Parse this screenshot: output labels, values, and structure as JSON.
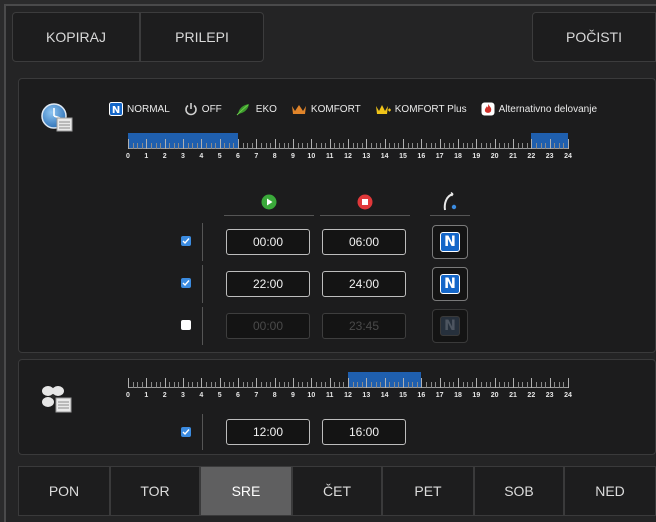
{
  "toolbar": {
    "copy_label": "KOPIRAJ",
    "paste_label": "PRILEPI",
    "clear_label": "POČISTI"
  },
  "legend": [
    {
      "label": "NORMAL",
      "icon": "normal-n-icon",
      "color": "#1466c8"
    },
    {
      "label": "OFF",
      "icon": "power-icon",
      "color": "#cfcfcf"
    },
    {
      "label": "EKO",
      "icon": "leaf-icon",
      "color": "#3c9a2c"
    },
    {
      "label": "KOMFORT",
      "icon": "crown-icon",
      "color": "#e0842a"
    },
    {
      "label": "KOMFORT Plus",
      "icon": "crown-plus-icon",
      "color": "#f0c419"
    },
    {
      "label": "Alternativno delovanje",
      "icon": "flame-icon",
      "color": "#d0302a"
    }
  ],
  "hours": [
    "0",
    "1",
    "2",
    "3",
    "4",
    "5",
    "6",
    "7",
    "8",
    "9",
    "10",
    "11",
    "12",
    "13",
    "14",
    "15",
    "16",
    "17",
    "18",
    "19",
    "20",
    "21",
    "22",
    "23",
    "24"
  ],
  "heating": {
    "timeline_segments": [
      [
        0,
        6
      ],
      [
        22,
        24
      ]
    ],
    "columns": {
      "start_icon": "play-icon",
      "stop_icon": "stop-icon",
      "mode_icon": "touch-icon"
    },
    "rows": [
      {
        "enabled": true,
        "start": "00:00",
        "end": "06:00",
        "mode": "N"
      },
      {
        "enabled": true,
        "start": "22:00",
        "end": "24:00",
        "mode": "N"
      },
      {
        "enabled": false,
        "start": "00:00",
        "end": "23:45",
        "mode": "N"
      }
    ]
  },
  "ventilation": {
    "timeline_segments": [
      [
        12,
        16
      ]
    ],
    "rows": [
      {
        "enabled": true,
        "start": "12:00",
        "end": "16:00"
      }
    ]
  },
  "days": [
    {
      "label": "PON",
      "active": false
    },
    {
      "label": "TOR",
      "active": false
    },
    {
      "label": "SRE",
      "active": true
    },
    {
      "label": "ČET",
      "active": false
    },
    {
      "label": "PET",
      "active": false
    },
    {
      "label": "SOB",
      "active": false
    },
    {
      "label": "NED",
      "active": false
    }
  ],
  "colors": {
    "accent": "#1f5fae",
    "checkbox": "#3b8be0"
  }
}
